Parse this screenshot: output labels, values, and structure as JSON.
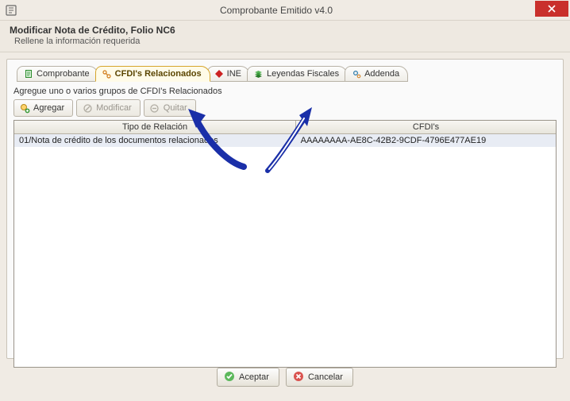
{
  "window": {
    "title": "Comprobante Emitido v4.0"
  },
  "header": {
    "title": "Modificar Nota de Crédito, Folio NC6",
    "subtitle": "Rellene la información requerida"
  },
  "tabs": [
    {
      "label": "Comprobante",
      "icon": "doc-green-icon"
    },
    {
      "label": "CFDI's Relacionados",
      "icon": "link-orange-icon",
      "active": true
    },
    {
      "label": "INE",
      "icon": "diamond-red-icon"
    },
    {
      "label": "Leyendas Fiscales",
      "icon": "stack-green-icon"
    },
    {
      "label": "Addenda",
      "icon": "gears-icon"
    }
  ],
  "instruction": "Agregue uno o varios grupos de CFDI's Relacionados",
  "toolbar": {
    "add": {
      "label": "Agregar",
      "enabled": true
    },
    "edit": {
      "label": "Modificar",
      "enabled": false
    },
    "remove": {
      "label": "Quitar",
      "enabled": false
    }
  },
  "table": {
    "columns": {
      "relation_type": "Tipo de Relación",
      "cfdis": "CFDI's"
    },
    "rows": [
      {
        "relation_type": "01/Nota de crédito de los documentos relacionados",
        "cfdis": "AAAAAAAA-AE8C-42B2-9CDF-4796E477AE19"
      }
    ]
  },
  "footer": {
    "accept": "Aceptar",
    "cancel": "Cancelar"
  }
}
